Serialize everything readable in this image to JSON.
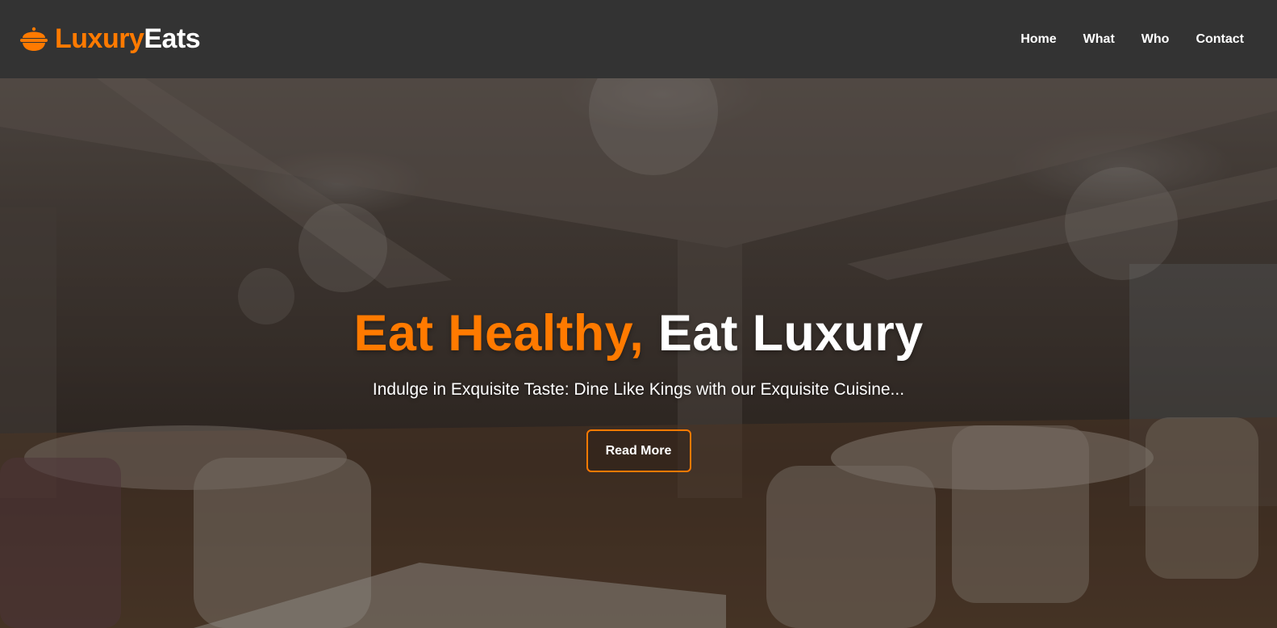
{
  "brand": {
    "icon": "food-bowl-icon",
    "name_part1": "Luxury",
    "name_part2": "Eats",
    "accent_color": "#ff7a00"
  },
  "nav": {
    "items": [
      {
        "label": "Home"
      },
      {
        "label": "What"
      },
      {
        "label": "Who"
      },
      {
        "label": "Contact"
      }
    ]
  },
  "hero": {
    "title_accent": "Eat Healthy,",
    "title_rest": "Eat Luxury",
    "subtitle": "Indulge in Exquisite Taste: Dine Like Kings with our Exquisite Cuisine...",
    "button_label": "Read More"
  }
}
